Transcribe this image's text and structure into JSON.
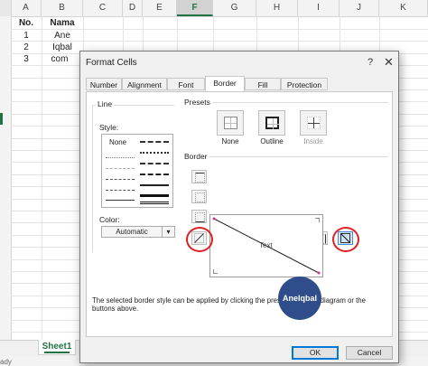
{
  "sheet": {
    "columns": [
      "A",
      "B",
      "C",
      "D",
      "E",
      "F",
      "G",
      "H",
      "I",
      "J",
      "K"
    ],
    "active_column": "F",
    "rows": [
      {
        "a": "No.",
        "b": "Nama",
        "bold": true
      },
      {
        "a": "1",
        "b": "Ane",
        "bold": false
      },
      {
        "a": "2",
        "b": "Iqbal",
        "bold": false
      },
      {
        "a": "3",
        "b": "com",
        "bold": false
      }
    ],
    "sheet_tab": "Sheet1",
    "add_sheet": "+",
    "status": "ady"
  },
  "dialog": {
    "title": "Format Cells",
    "help": "?",
    "close": "✕",
    "tabs": [
      "Number",
      "Alignment",
      "Font",
      "Border",
      "Fill",
      "Protection"
    ],
    "active_tab": "Border",
    "line_group": "Line",
    "style_label": "Style:",
    "style_none": "None",
    "color_label": "Color:",
    "color_value": "Automatic",
    "presets_label": "Presets",
    "presets": [
      {
        "label": "None",
        "enabled": true
      },
      {
        "label": "Outline",
        "enabled": true
      },
      {
        "label": "Inside",
        "enabled": false
      }
    ],
    "border_label": "Border",
    "preview_text": "Text",
    "hint": "The selected border style can be applied by clicking the presets, preview diagram or the buttons above.",
    "watermark": "AneIqbal",
    "ok_label": "OK",
    "cancel_label": "Cancel"
  },
  "colors": {
    "excel_green": "#217346",
    "highlight_ring": "#e02020",
    "watermark_bg": "#2e4d8a"
  }
}
